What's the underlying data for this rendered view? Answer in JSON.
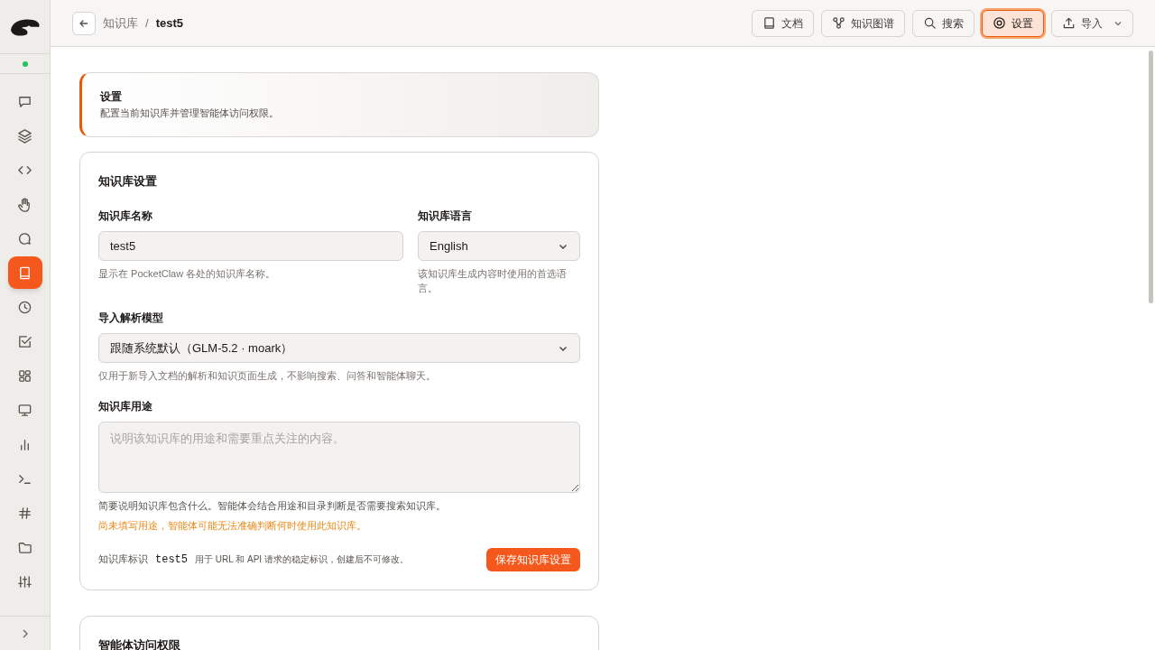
{
  "breadcrumb": {
    "parent": "知识库",
    "separator": "/",
    "current": "test5"
  },
  "toolbar": [
    {
      "label": "文档",
      "selected": false,
      "kind": "button"
    },
    {
      "label": "知识图谱",
      "selected": false,
      "kind": "button"
    },
    {
      "label": "搜索",
      "selected": false,
      "kind": "button"
    },
    {
      "label": "设置",
      "selected": true,
      "kind": "button"
    },
    {
      "label": "导入",
      "selected": false,
      "kind": "dropdown"
    }
  ],
  "nav_items": [
    {
      "selected": false
    },
    {
      "selected": false
    },
    {
      "selected": false
    },
    {
      "selected": false
    },
    {
      "selected": false
    },
    {
      "selected": true
    },
    {
      "selected": false
    },
    {
      "selected": false
    },
    {
      "selected": false
    },
    {
      "selected": false
    },
    {
      "selected": false
    },
    {
      "selected": false
    },
    {
      "selected": false
    },
    {
      "selected": false
    },
    {
      "selected": false
    }
  ],
  "intro": {
    "title": "设置",
    "subtitle": "配置当前知识库并管理智能体访问权限。"
  },
  "settings_card": {
    "title": "知识库设置",
    "name_field": {
      "label": "知识库名称",
      "value": "test5",
      "help": "显示在 PocketClaw 各处的知识库名称。"
    },
    "language_field": {
      "label": "知识库语言",
      "value": "English",
      "help": "该知识库生成内容时使用的首选语言。"
    },
    "model_field": {
      "label": "导入解析模型",
      "value": "跟随系统默认（GLM-5.2 · moark）",
      "help": "仅用于新导入文档的解析和知识页面生成，不影响搜索、问答和智能体聊天。"
    },
    "purpose_field": {
      "label": "知识库用途",
      "placeholder": "说明该知识库的用途和需要重点关注的内容。",
      "help": "简要说明知识库包含什么。智能体会结合用途和目录判断是否需要搜索知识库。",
      "warning": "尚未填写用途，智能体可能无法准确判断何时使用此知识库。"
    },
    "identifier": {
      "label": "知识库标识",
      "value": "test5",
      "note": "用于 URL 和 API 请求的稳定标识，创建后不可修改。"
    },
    "save_button": "保存知识库设置"
  },
  "access_card": {
    "title": "智能体访问权限"
  }
}
